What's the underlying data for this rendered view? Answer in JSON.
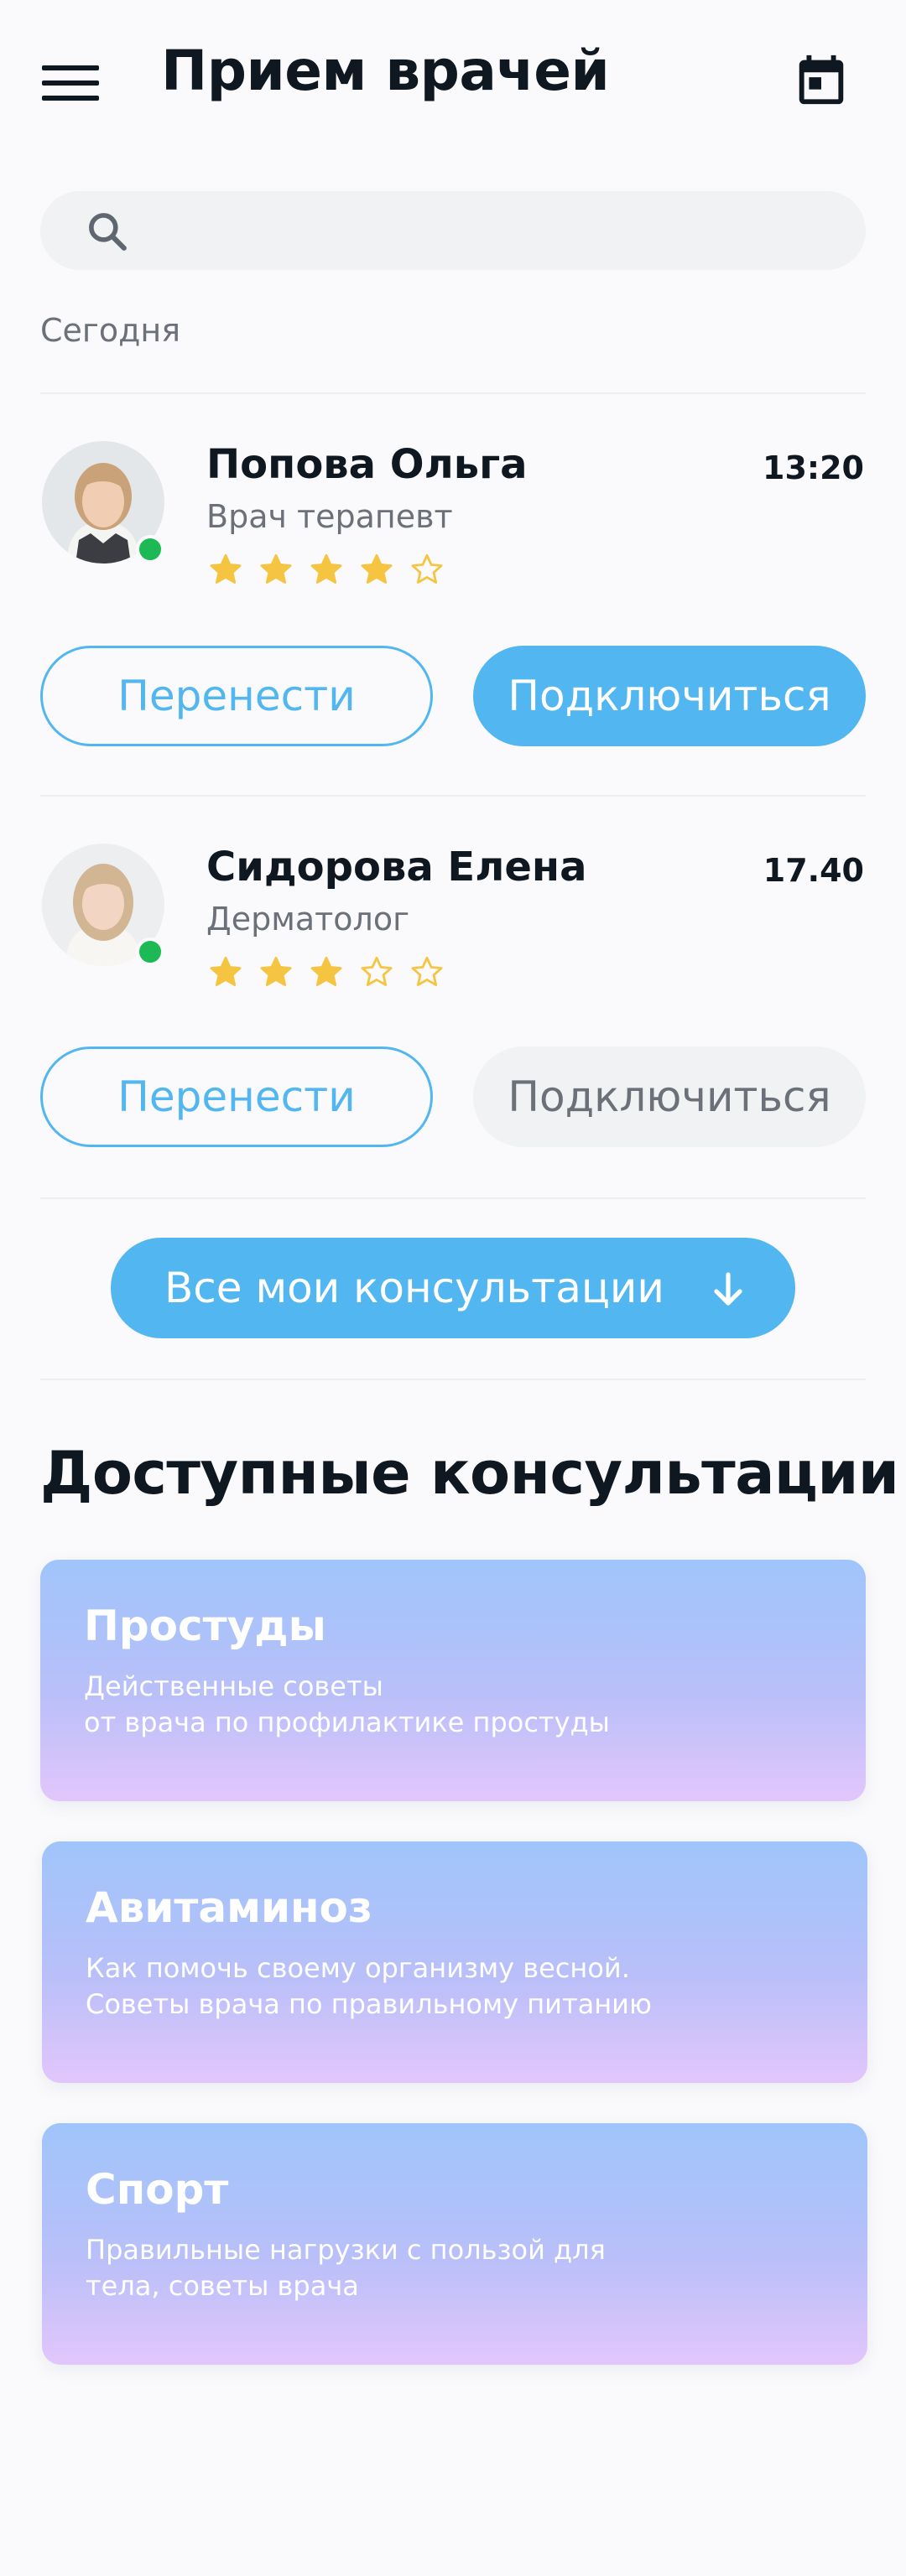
{
  "header": {
    "title": "Прием врачей",
    "menu_icon": "menu-icon",
    "calendar_icon": "calendar-icon"
  },
  "search": {
    "placeholder": "",
    "value": "",
    "icon": "search-icon"
  },
  "appointments": {
    "section_label": "Сегодня",
    "items": [
      {
        "name": "Попова Ольга",
        "specialty": "Врач терапевт",
        "time": "13:20",
        "rating": 4,
        "rating_max": 5,
        "online": true,
        "reschedule_label": "Перенести",
        "connect_label": "Подключиться",
        "connect_enabled": true
      },
      {
        "name": "Сидорова Елена",
        "specialty": "Дерматолог",
        "time": "17.40",
        "rating": 3,
        "rating_max": 5,
        "online": true,
        "reschedule_label": "Перенести",
        "connect_label": "Подключиться",
        "connect_enabled": false
      }
    ],
    "all_button_label": "Все мои консультации"
  },
  "available": {
    "title": "Доступные консультации",
    "cards": [
      {
        "title": "Простуды",
        "desc_line1": "Действенные советы",
        "desc_line2": "от врача по профилактике простуды"
      },
      {
        "title": "Авитаминоз",
        "desc_line1": "Как помочь своему организму весной.",
        "desc_line2": "Советы врача по правильному питанию"
      },
      {
        "title": "Спорт",
        "desc_line1": "Правильные нагрузки с пользой для",
        "desc_line2": "тела, советы врача"
      }
    ]
  },
  "colors": {
    "accent": "#52b6f0",
    "star": "#f5c542",
    "online": "#1db954",
    "text": "#0f1720",
    "muted": "#6b7079"
  }
}
